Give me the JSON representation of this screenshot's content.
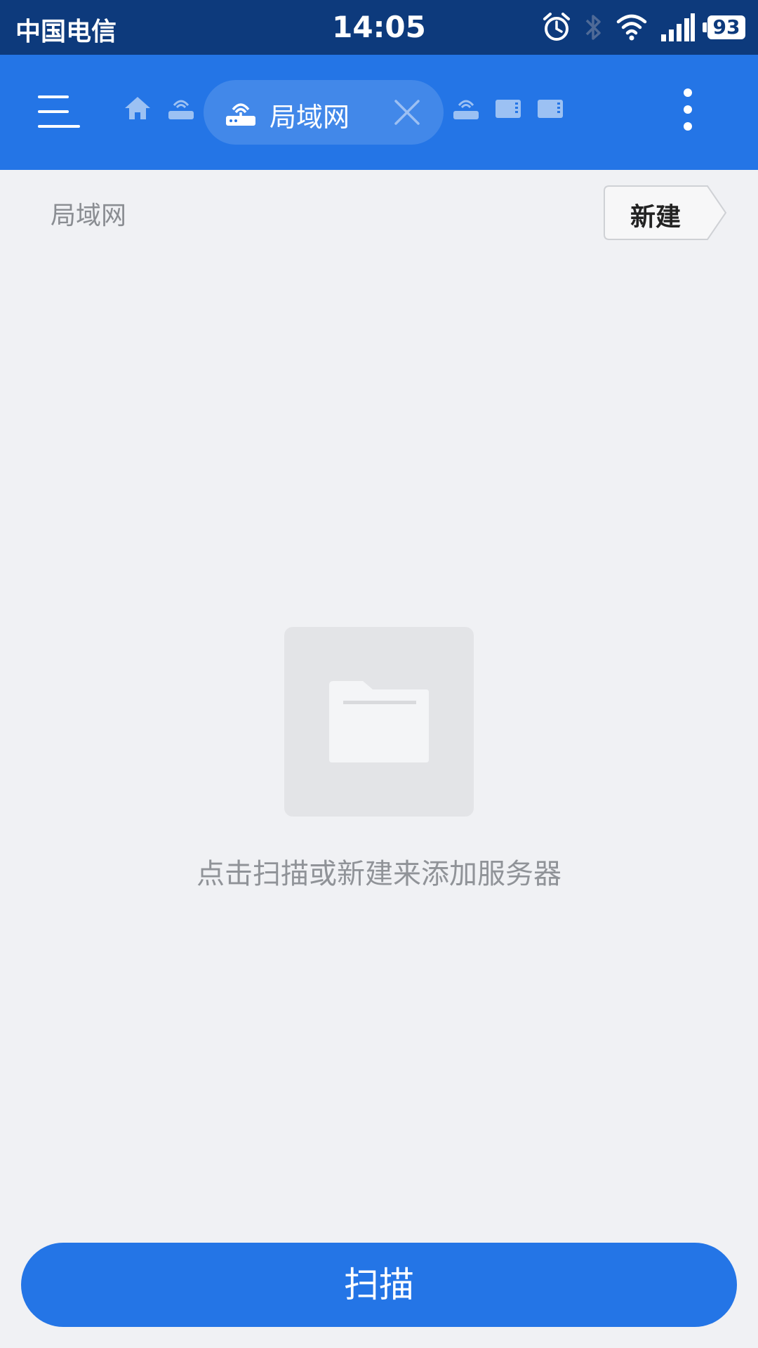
{
  "status_bar": {
    "carrier": "中国电信",
    "time": "14:05",
    "battery": "93",
    "icons": [
      "alarm-icon",
      "bluetooth-icon",
      "wifi-icon",
      "signal-icon",
      "battery-icon"
    ]
  },
  "toolbar": {
    "menu_icon": "hamburger-menu-icon",
    "path_icons": [
      "home-icon",
      "router-icon"
    ],
    "active_tab": {
      "label": "局域网",
      "icon": "router-icon",
      "close_icon": "close-icon"
    },
    "trailing_icons": [
      "router-icon",
      "storage-icon",
      "storage-icon"
    ],
    "more_icon": "more-vertical-icon"
  },
  "breadcrumb": {
    "label": "局域网"
  },
  "new_button": {
    "label": "新建"
  },
  "empty_state": {
    "icon": "folder-icon",
    "message": "点击扫描或新建来添加服务器"
  },
  "scan_button": {
    "label": "扫描"
  },
  "colors": {
    "status_bar": "#0d3a7c",
    "toolbar": "#2475e6",
    "background": "#f0f1f4",
    "accent": "#2475e6"
  }
}
